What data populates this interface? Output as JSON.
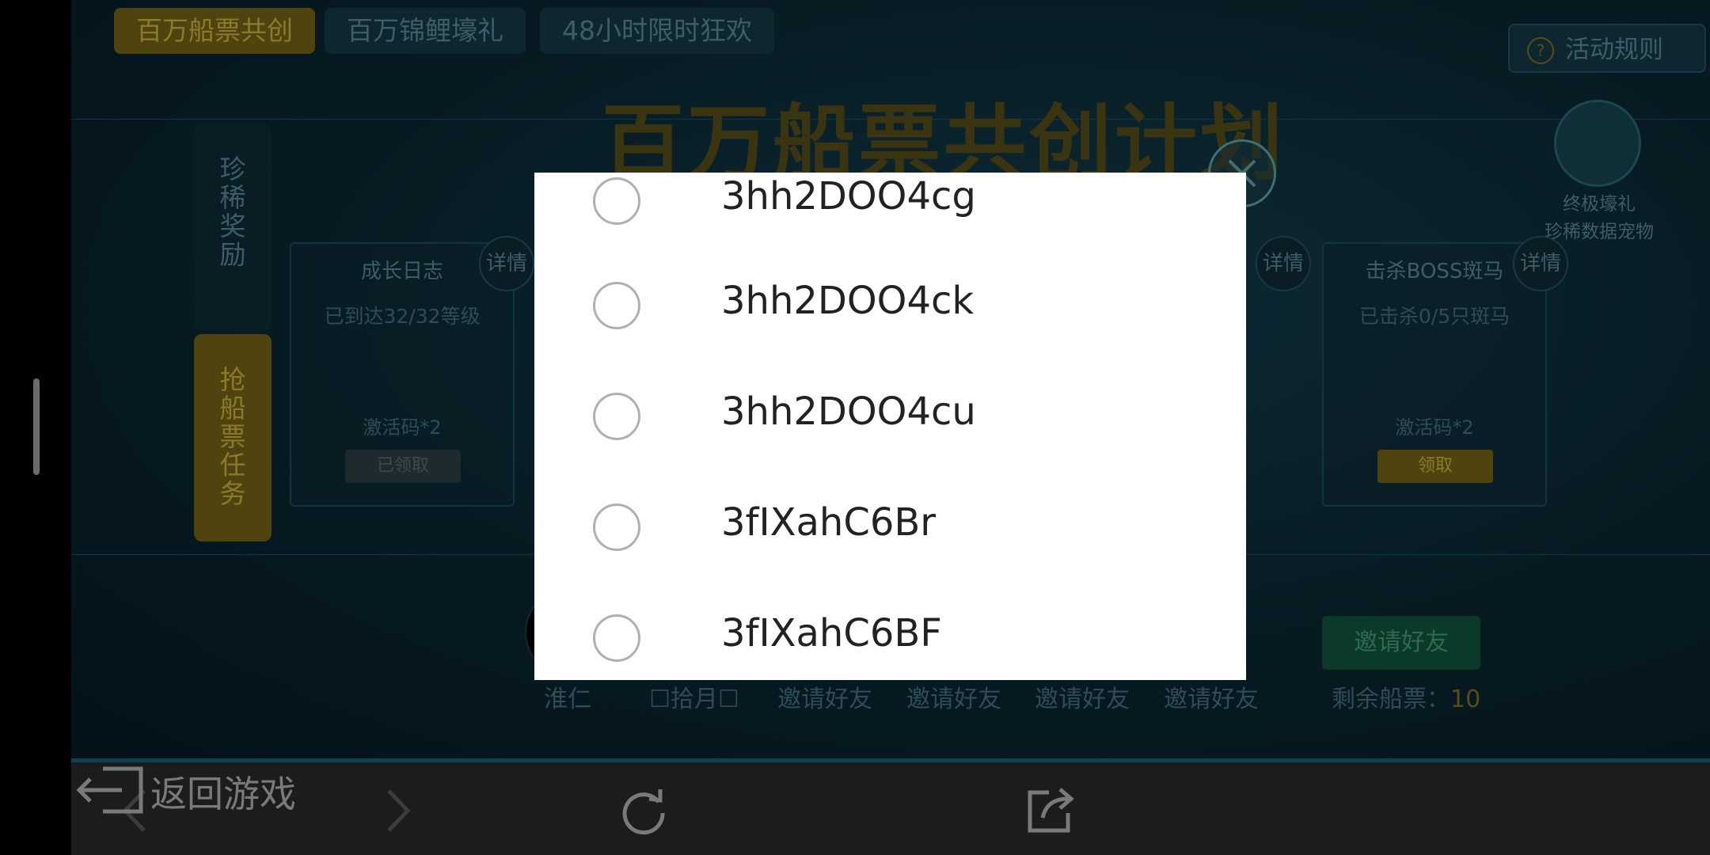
{
  "tabs": [
    "百万船票共创",
    "百万锦鲤壕礼",
    "48小时限时狂欢"
  ],
  "rules_button": "活动规则",
  "main_title": "百万船票共创计划",
  "pet_caption": [
    "终极壕礼",
    "珍稀数据宠物"
  ],
  "side_tabs": [
    "珍稀奖励",
    "抢船票任务"
  ],
  "cards": [
    {
      "title": "成长日志",
      "status": "已到达32/32等级",
      "reward": "激活码*2",
      "button": "已领取"
    },
    {
      "title": "击杀BOSS斑马",
      "status": "已击杀0/5只斑马",
      "reward": "激活码*2",
      "button": "领取"
    }
  ],
  "detail_label": "详情",
  "bottom": {
    "names": [
      "淮仁",
      "☐拾月☐",
      "邀请好友",
      "邀请好友",
      "邀请好友",
      "邀请好友"
    ],
    "invite_button": "邀请好友",
    "remaining_label": "剩余船票：",
    "remaining_value": "10"
  },
  "dialog": {
    "options": [
      "3hh2DOO4cg",
      "3hh2DOO4ck",
      "3hh2DOO4cu",
      "3fIXahC6Br",
      "3fIXahC6BF"
    ]
  },
  "toolbar": {
    "back_icon": "chevron-left-icon",
    "forward_icon": "chevron-right-icon",
    "reload_icon": "reload-icon",
    "share_icon": "share-icon",
    "return_label": "返回游戏"
  }
}
